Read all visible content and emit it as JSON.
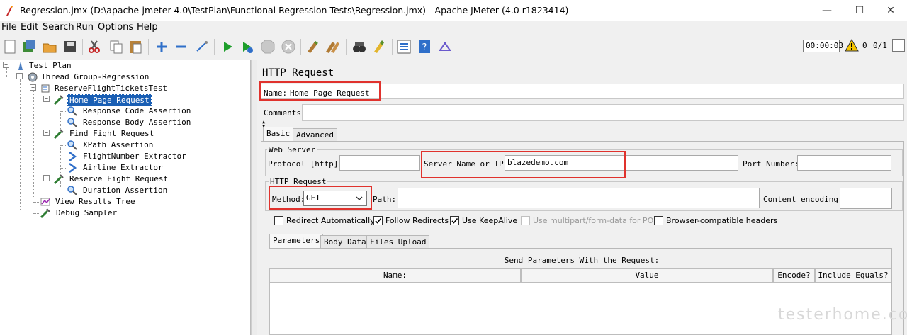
{
  "window": {
    "title": "Regression.jmx (D:\\apache-jmeter-4.0\\TestPlan\\Functional Regression Tests\\Regression.jmx) - Apache JMeter (4.0 r1823414)",
    "minimize": "—",
    "maximize": "☐",
    "close": "✕"
  },
  "menu": {
    "file": "File",
    "edit": "Edit",
    "search": "Search",
    "run": "Run",
    "options": "Options",
    "help": "Help"
  },
  "status": {
    "timer": "00:00:03",
    "warnings": "0",
    "threads": "0/1"
  },
  "tree": {
    "items": [
      {
        "label": "Test Plan",
        "icon": "test-plan-icon"
      },
      {
        "label": "Thread Group-Regression",
        "icon": "thread-group-icon"
      },
      {
        "label": "ReserveFlightTicketsTest",
        "icon": "controller-icon"
      },
      {
        "label": "Home Page Request",
        "icon": "sampler-icon"
      },
      {
        "label": "Response Code Assertion",
        "icon": "assertion-icon"
      },
      {
        "label": "Response Body Assertion",
        "icon": "assertion-icon"
      },
      {
        "label": "Find Fight Request",
        "icon": "sampler-icon"
      },
      {
        "label": "XPath Assertion",
        "icon": "assertion-icon"
      },
      {
        "label": "FlightNumber Extractor",
        "icon": "extractor-icon"
      },
      {
        "label": "Airline Extractor",
        "icon": "extractor-icon"
      },
      {
        "label": "Reserve Fight Request",
        "icon": "sampler-icon"
      },
      {
        "label": "Duration Assertion",
        "icon": "assertion-icon"
      },
      {
        "label": "View Results Tree",
        "icon": "listener-icon"
      },
      {
        "label": "Debug Sampler",
        "icon": "sampler-icon"
      }
    ]
  },
  "panel": {
    "title": "HTTP Request",
    "name_label": "Name:",
    "name_value": "Home Page Request",
    "comments_label": "Comments:",
    "tabs": [
      "Basic",
      "Advanced"
    ],
    "web_server": {
      "legend": "Web Server",
      "protocol_label": "Protocol [http]:",
      "server_label": "Server Name or IP:",
      "server_value": "blazedemo.com",
      "port_label": "Port Number:"
    },
    "http_request": {
      "legend": "HTTP Request",
      "method_label": "Method:",
      "method_value": "GET",
      "path_label": "Path:",
      "encoding_label": "Content encoding:"
    },
    "options": {
      "redirect_auto": "Redirect Automatically",
      "follow_redirects": "Follow Redirects",
      "keepalive": "Use KeepAlive",
      "multipart": "Use multipart/form-data for POST",
      "browser_headers": "Browser-compatible headers"
    },
    "param_tabs": [
      "Parameters",
      "Body Data",
      "Files Upload"
    ],
    "params": {
      "caption": "Send Parameters With the Request:",
      "columns": [
        "Name:",
        "Value",
        "Encode?",
        "Include Equals?"
      ]
    }
  },
  "watermark": "testerhome.com"
}
